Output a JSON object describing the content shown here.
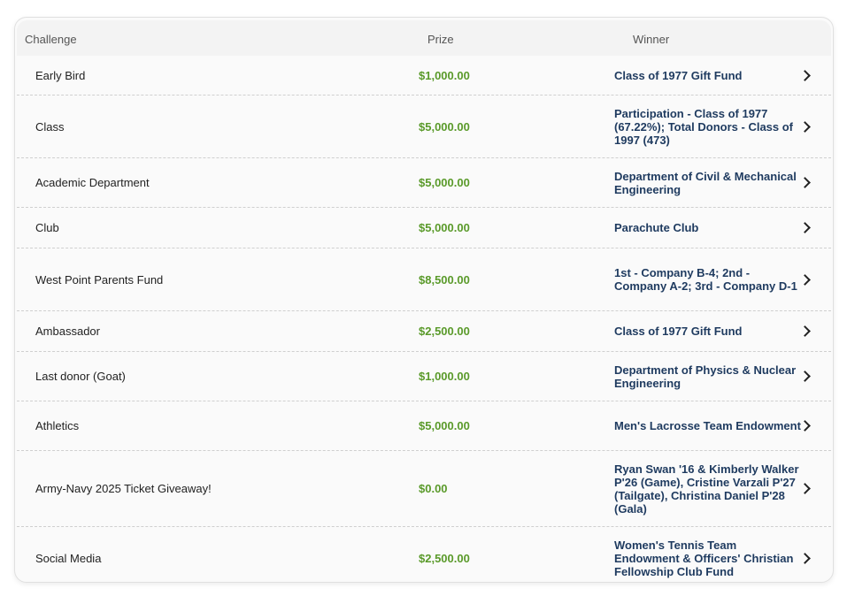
{
  "table": {
    "headers": {
      "challenge": "Challenge",
      "prize": "Prize",
      "winner": "Winner"
    },
    "rows": [
      {
        "challenge": "Early Bird",
        "prize": "$1,000.00",
        "winner": "Class of 1977 Gift Fund"
      },
      {
        "challenge": "Class",
        "prize": "$5,000.00",
        "winner": "Participation - Class of 1977 (67.22%); Total Donors - Class of 1997 (473)"
      },
      {
        "challenge": "Academic Department",
        "prize": "$5,000.00",
        "winner": "Department of Civil & Mechanical Engineering"
      },
      {
        "challenge": "Club",
        "prize": "$5,000.00",
        "winner": "Parachute Club"
      },
      {
        "challenge": "West Point Parents Fund",
        "prize": "$8,500.00",
        "winner": "1st - Company B-4; 2nd - Company A-2; 3rd - Company D-1"
      },
      {
        "challenge": "Ambassador",
        "prize": "$2,500.00",
        "winner": "Class of 1977 Gift Fund"
      },
      {
        "challenge": "Last donor (Goat)",
        "prize": "$1,000.00",
        "winner": "Department of Physics & Nuclear Engineering"
      },
      {
        "challenge": "Athletics",
        "prize": "$5,000.00",
        "winner": "Men's Lacrosse Team Endowment"
      },
      {
        "challenge": "Army-Navy 2025 Ticket Giveaway!",
        "prize": "$0.00",
        "winner": "Ryan Swan '16 & Kimberly Walker P'26 (Game), Cristine Varzali P'27 (Tailgate), Christina Daniel P'28 (Gala)"
      },
      {
        "challenge": "Social Media",
        "prize": "$2,500.00",
        "winner": "Women's Tennis Team Endowment & Officers' Christian Fellowship Club Fund"
      }
    ]
  },
  "icons": {
    "row_action": "chevron-right-icon"
  },
  "colors": {
    "prize": "#5a9a2a",
    "winner": "#1e3a5f"
  }
}
